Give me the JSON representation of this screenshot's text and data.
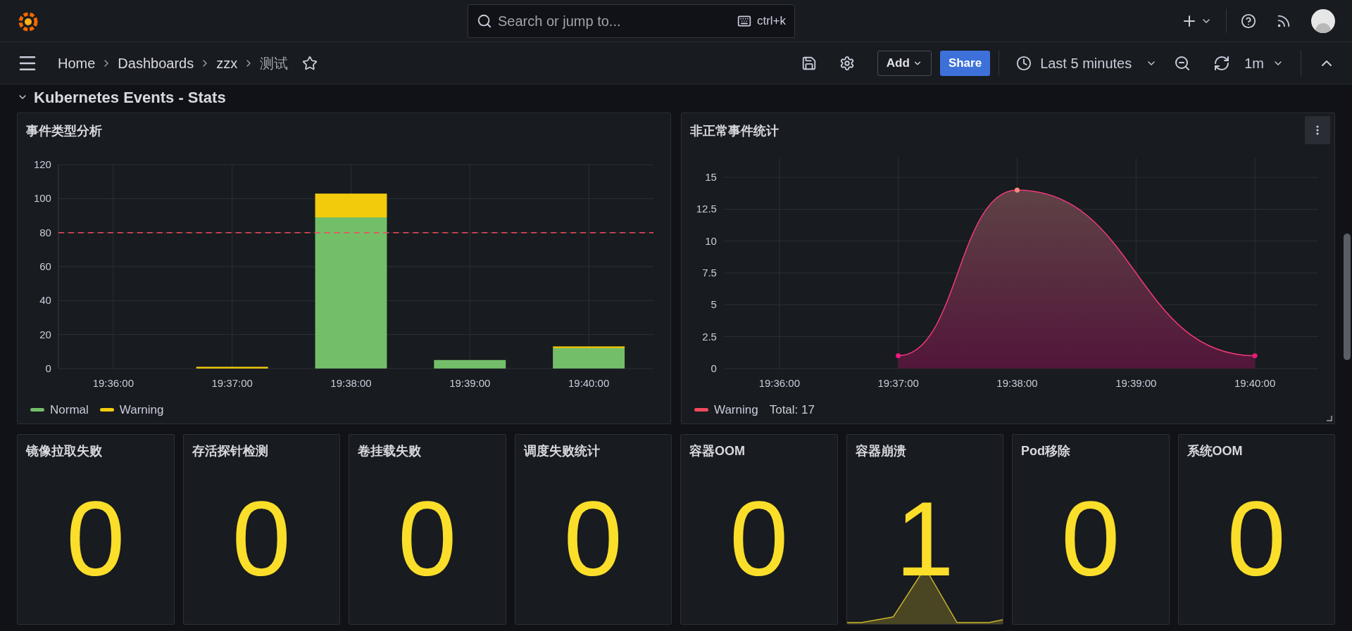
{
  "top_bar": {
    "search": {
      "placeholder": "Search or jump to...",
      "shortcut": "ctrl+k"
    }
  },
  "nav": {
    "breadcrumbs": [
      {
        "label": "Home"
      },
      {
        "label": "Dashboards"
      },
      {
        "label": "zzx"
      },
      {
        "label": "测试"
      }
    ],
    "add_button": "Add",
    "share_button": "Share",
    "time_range": "Last 5 minutes",
    "refresh_interval": "1m"
  },
  "row": {
    "title": "Kubernetes Events - Stats",
    "expanded": true
  },
  "charts": [
    {
      "title": "事件类型分析",
      "chart_data": {
        "type": "bar",
        "stacked": true,
        "categories": [
          "19:36:00",
          "19:37:00",
          "19:38:00",
          "19:39:00",
          "19:40:00"
        ],
        "ylim": [
          0,
          120
        ],
        "yticks": [
          0,
          20,
          40,
          60,
          80,
          100,
          120
        ],
        "series": [
          {
            "name": "Normal",
            "color": "#73bf69",
            "values": [
              0,
              0,
              89,
              5,
              12
            ]
          },
          {
            "name": "Warning",
            "color": "#f2cc0c",
            "values": [
              0,
              1,
              14,
              0,
              1
            ]
          }
        ],
        "grid": true,
        "ref_lines": [
          {
            "axis": "y",
            "value": 80,
            "color": "#f2495c"
          }
        ]
      }
    },
    {
      "title": "非正常事件统计",
      "menu_hover": true,
      "legend_total": "Total: 17",
      "chart_data": {
        "type": "area",
        "grid": true,
        "categories": [
          "19:36:00",
          "19:37:00",
          "19:38:00",
          "19:39:00",
          "19:40:00"
        ],
        "ylim": [
          0,
          15
        ],
        "yticks": [
          0,
          2.5,
          5,
          7.5,
          10,
          12.5,
          15
        ],
        "series": [
          {
            "name": "Warning",
            "color": "#f2495c",
            "values": [
              null,
              1,
              14,
              null,
              1
            ]
          }
        ]
      }
    }
  ],
  "stats": [
    {
      "title": "镜像拉取失败",
      "value": "0",
      "kind": "plain"
    },
    {
      "title": "存活探针检测",
      "value": "0",
      "kind": "plain"
    },
    {
      "title": "卷挂载失败",
      "value": "0",
      "kind": "plain"
    },
    {
      "title": "调度失败统计",
      "value": "0",
      "kind": "plain"
    },
    {
      "title": "容器OOM",
      "value": "0",
      "kind": "plain"
    },
    {
      "title": "容器崩溃",
      "value": "1",
      "kind": "sparkline"
    },
    {
      "title": "Pod移除",
      "value": "0",
      "kind": "plain"
    },
    {
      "title": "系统OOM",
      "value": "0",
      "kind": "plain"
    }
  ]
}
